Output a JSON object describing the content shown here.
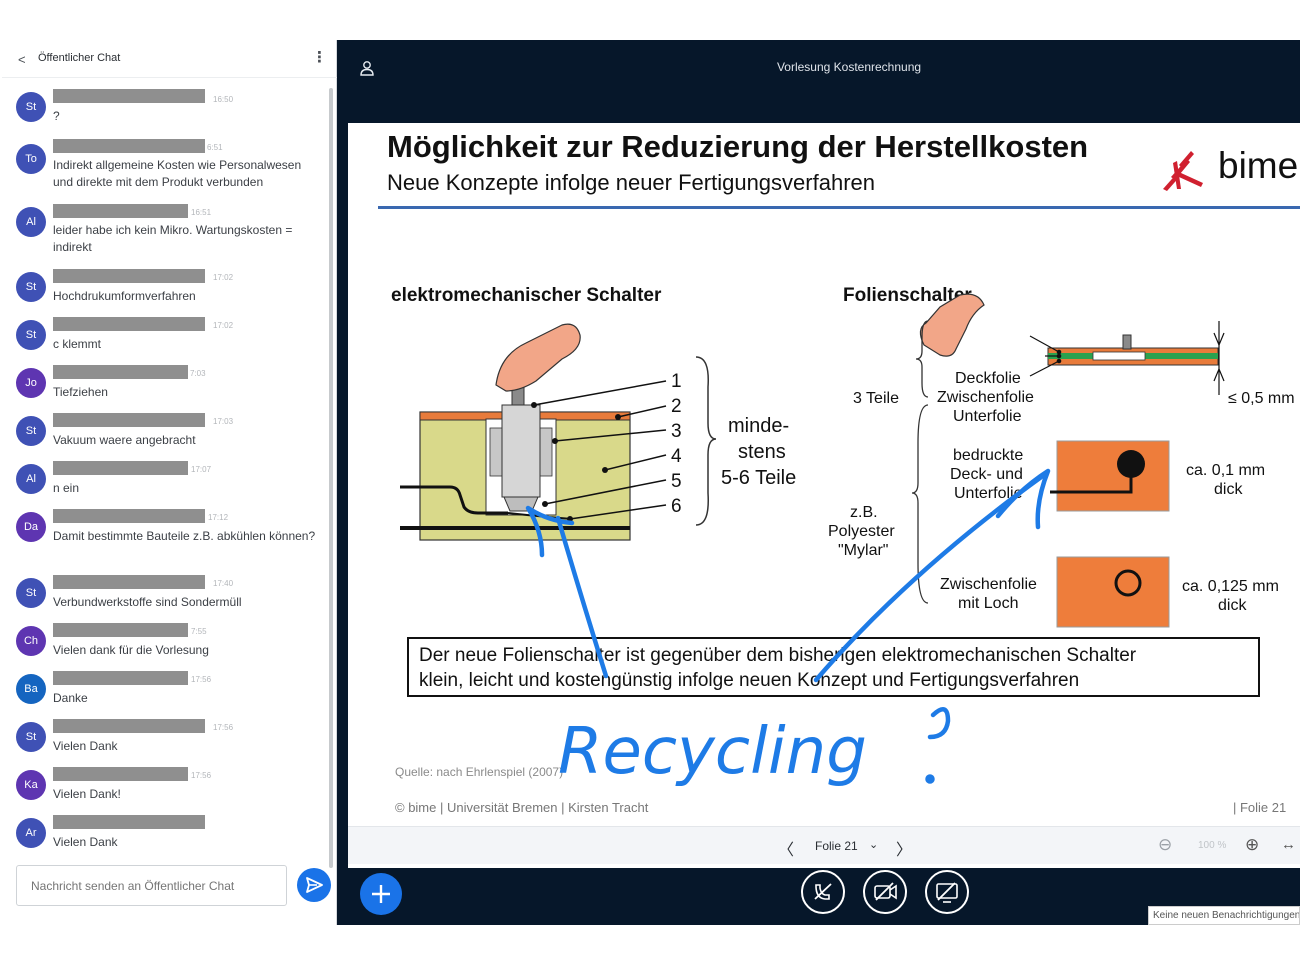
{
  "chat": {
    "back_label": "<",
    "title": "Öffentlicher Chat",
    "menu_label": "⋮",
    "messages": [
      {
        "initials": "St",
        "color": "#3f51b5",
        "time": "16:50",
        "text": "?"
      },
      {
        "initials": "To",
        "color": "#3f51b5",
        "time": "6:51",
        "text": "Indirekt allgemeine Kosten wie Personalwesen und direkte mit dem Produkt verbunden"
      },
      {
        "initials": "Al",
        "color": "#3f51b5",
        "time": "16:51",
        "text": "leider habe ich kein Mikro. Wartungskosten = indirekt"
      },
      {
        "initials": "St",
        "color": "#3f51b5",
        "time": "17:02",
        "text": "Hochdrukumformverfahren"
      },
      {
        "initials": "St",
        "color": "#3f51b5",
        "time": "17:02",
        "text": "c klemmt"
      },
      {
        "initials": "Jo",
        "color": "#5e35b1",
        "time": "7:03",
        "text": "Tiefziehen"
      },
      {
        "initials": "St",
        "color": "#3f51b5",
        "time": "17:03",
        "text": "Vakuum waere angebracht"
      },
      {
        "initials": "Al",
        "color": "#3f51b5",
        "time": "17:07",
        "text": "n ein"
      },
      {
        "initials": "Da",
        "color": "#5e35b1",
        "time": "17:12",
        "text": "Damit bestimmte Bauteile z.B. abkühlen können?"
      },
      {
        "initials": "St",
        "color": "#3f51b5",
        "time": "17:40",
        "text": "Verbundwerkstoffe sind Sondermüll"
      },
      {
        "initials": "Ch",
        "color": "#5e35b1",
        "time": "7:55",
        "text": "Vielen dank für die Vorlesung"
      },
      {
        "initials": "Ba",
        "color": "#1565c0",
        "time": "17:56",
        "text": "Danke"
      },
      {
        "initials": "St",
        "color": "#3f51b5",
        "time": "17:56",
        "text": "Vielen Dank"
      },
      {
        "initials": "Ka",
        "color": "#5e35b1",
        "time": "17:56",
        "text": "Vielen Dank!"
      },
      {
        "initials": "Ar",
        "color": "#3f51b5",
        "time": "",
        "text": "Vielen Dank"
      }
    ],
    "input_placeholder": "Nachricht senden an Öffentlicher Chat"
  },
  "presentation": {
    "title": "Vorlesung Kostenrechnung",
    "slide": {
      "title": "Möglichkeit zur Reduzierung der Herstellkosten",
      "subtitle": "Neue Konzepte infolge neuer Fertigungsverfahren",
      "logo_text": "bime",
      "left_heading": "elektromechanischer Schalter",
      "right_heading": "Folienschalter",
      "part_numbers": [
        "1",
        "2",
        "3",
        "4",
        "5",
        "6"
      ],
      "min_parts_1": "minde-",
      "min_parts_2": "stens",
      "min_parts_3": "5-6 Teile",
      "three_parts": "3 Teile",
      "layer_top": "Deckfolie",
      "layer_mid": "Zwischenfolie",
      "layer_bottom": "Unterfolie",
      "thickness_total": "≤ 0,5 mm",
      "printed_1": "bedruckte",
      "printed_2": "Deck- und",
      "printed_3": "Unterfolie",
      "polyester_1": "z.B.",
      "polyester_2": "Polyester",
      "polyester_3": "\"Mylar\"",
      "thick_1_a": "ca. 0,1 mm",
      "thick_1_b": "dick",
      "spacer_1": "Zwischenfolie",
      "spacer_2": "mit Loch",
      "thick_2_a": "ca. 0,125 mm",
      "thick_2_b": "dick",
      "note_line1": "Der neue Folienschalter ist gegenüber dem bisherigen elektromechanischen Schalter",
      "note_line2": "klein, leicht und kostengünstig infolge neuen Konzept und Fertigungsverfahren",
      "source": "Quelle: nach Ehrlenspiel (2007)",
      "footer_left": "© bime | Universität Bremen | Kirsten Tracht",
      "footer_right": "| Folie 21",
      "annotation_word": "Recycling",
      "annotation_mark": "?"
    },
    "toolbar": {
      "prev_label": "〈",
      "slide_label": "Folie 21",
      "dropdown_label": "⌄",
      "next_label": "〉",
      "zoom_out_label": "⊖",
      "zoom_level": "100 %",
      "zoom_in_label": "⊕",
      "fit_label": "↔"
    },
    "notification": "Keine neuen Benachrichtigungen"
  },
  "colors": {
    "accent": "#1a73e8",
    "presentation_bg": "#06172a",
    "ink": "#1e7be6",
    "foil_orange": "#ee7d3b",
    "brand_red": "#d0202f"
  }
}
